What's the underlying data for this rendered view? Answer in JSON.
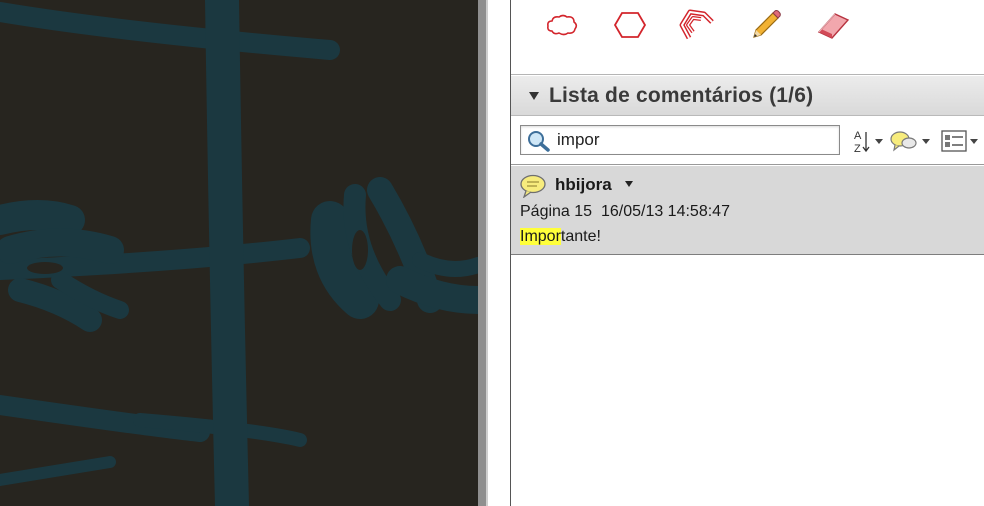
{
  "toolbar_tools": [
    {
      "name": "cloud-icon",
      "color": "#d3252c"
    },
    {
      "name": "polygon-icon",
      "color": "#d3252c"
    },
    {
      "name": "polyline-icon",
      "color": "#d3252c"
    },
    {
      "name": "pencil-icon",
      "color": "#e8a623"
    },
    {
      "name": "eraser-icon",
      "color": "#d3252c"
    }
  ],
  "comment_list": {
    "title": "Lista de comentários (1/6)"
  },
  "search": {
    "value": "impor",
    "icon": "magnifier-icon"
  },
  "list_toolbar": {
    "sort_icon": "sort-az-icon",
    "filter_icon": "filter-comments-icon",
    "options_icon": "list-options-icon"
  },
  "comments": [
    {
      "author": "hbijora",
      "page": "Página 15",
      "datetime": "16/05/13 14:58:47",
      "text_match": "Impor",
      "text_rest": "tante!",
      "icon": "speech-bubble-icon"
    }
  ],
  "colors": {
    "highlight": "#ffff3a",
    "document_bg": "#27251f",
    "document_ink": "#1b3840"
  }
}
